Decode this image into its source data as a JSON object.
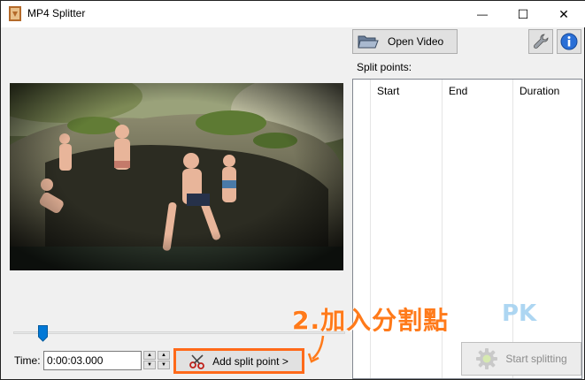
{
  "window": {
    "title": "MP4 Splitter",
    "minimize_glyph": "—",
    "maximize_glyph": "☐",
    "close_glyph": "✕"
  },
  "toolbar": {
    "open_video_label": "Open Video",
    "settings_icon": "wrench-icon",
    "info_icon": "info-icon"
  },
  "split_points": {
    "label": "Split points:",
    "columns": [
      "Start",
      "End",
      "Duration"
    ]
  },
  "playback": {
    "time_label": "Time:",
    "time_value": "0:00:03.000",
    "slider_position_fraction": 0.08
  },
  "actions": {
    "add_split_label": "Add split point >",
    "start_splitting_label": "Start splitting"
  },
  "annotation": {
    "callout_text": "2.加入分割點"
  },
  "watermark": {
    "text": "PK"
  },
  "colors": {
    "highlight_border": "#ff6a1a",
    "callout": "#ff7a1a",
    "info_blue": "#2a6fd6"
  }
}
